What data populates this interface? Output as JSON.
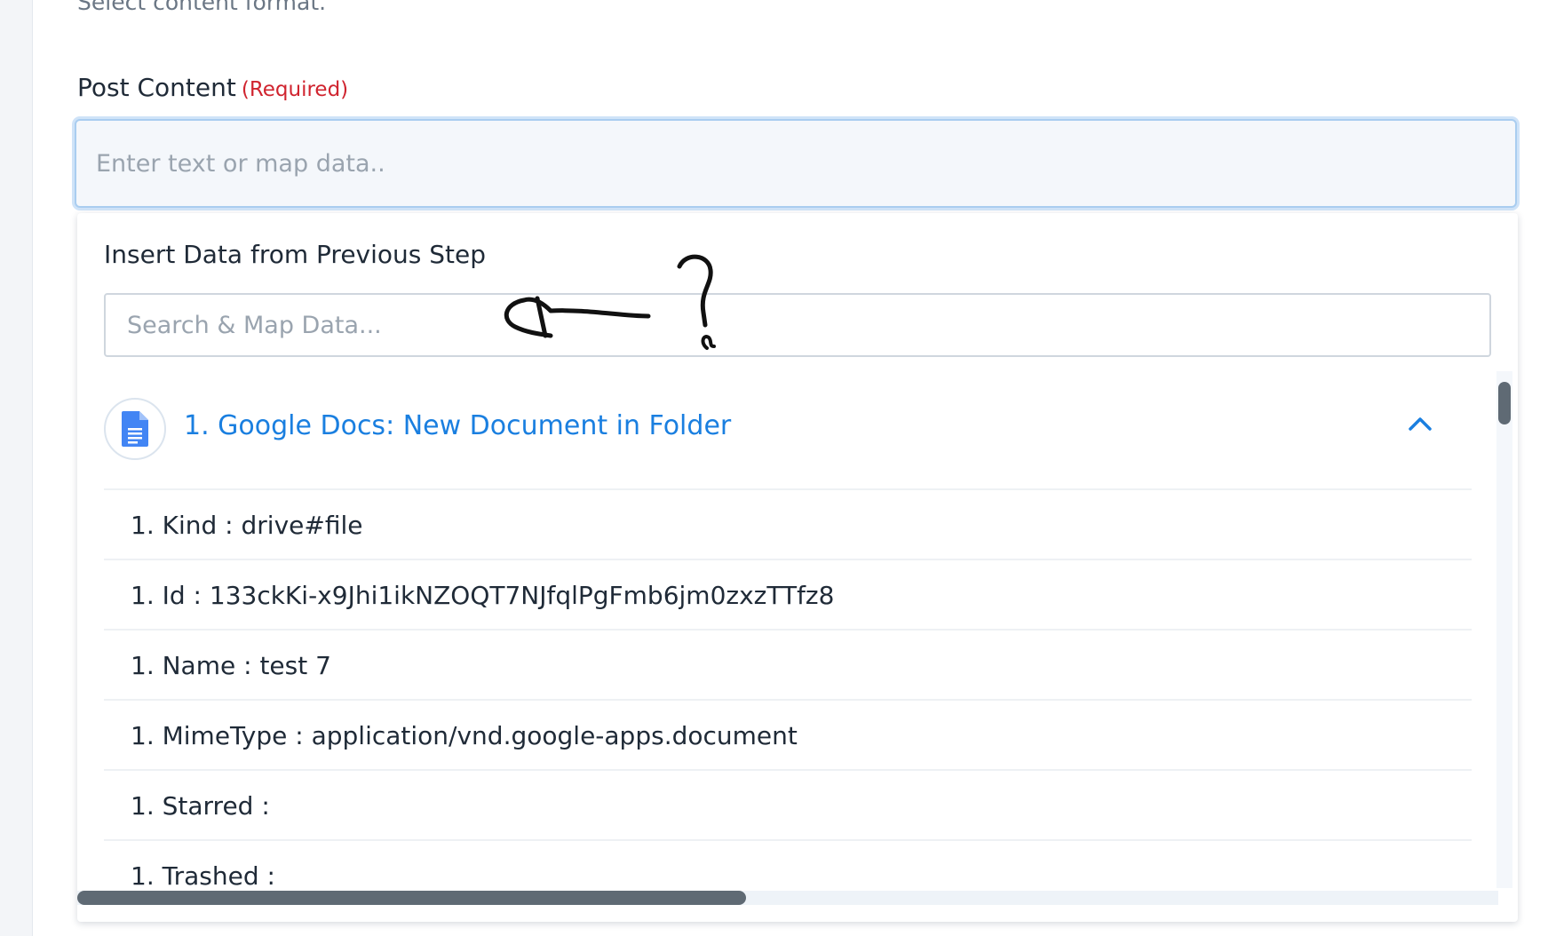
{
  "hint": {
    "text": "Select content format."
  },
  "post_content": {
    "label": "Post Content",
    "required_label": "(Required)",
    "placeholder": "Enter text or map data..",
    "value": ""
  },
  "mapper": {
    "title": "Insert Data from Previous Step",
    "search_placeholder": "Search & Map Data...",
    "search_value": "",
    "group": {
      "title": "1. Google Docs: New Document in Folder",
      "icon": "google-docs-icon",
      "expanded": true,
      "items": [
        {
          "label": "1. Kind : drive#file"
        },
        {
          "label": "1. Id : 133ckKi-x9Jhi1ikNZOQT7NJfqlPgFmb6jm0zxzTTfz8"
        },
        {
          "label": "1. Name : test 7"
        },
        {
          "label": "1. MimeType : application/vnd.google-apps.document"
        },
        {
          "label": "1. Starred :"
        },
        {
          "label": "1. Trashed :"
        }
      ]
    }
  },
  "colors": {
    "accent": "#1a7fe0",
    "required": "#d0242f",
    "input_focus_border": "#a9cdf0",
    "docs_blue": "#4285f4"
  }
}
